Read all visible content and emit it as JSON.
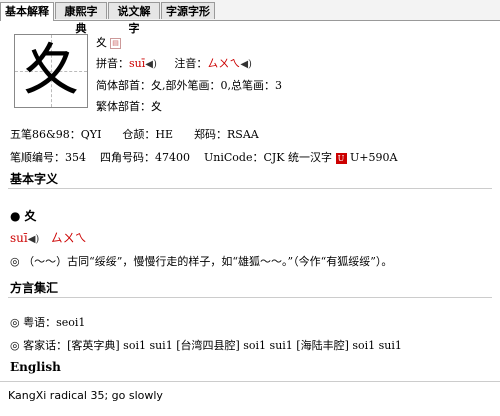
{
  "tabs": [
    "基本解释",
    "康熙字典",
    "说文解字",
    "字源字形"
  ],
  "char": "夊",
  "header": {
    "char_small": "夊",
    "pinyin_label": "拼音：",
    "pinyin": "suī",
    "zhuyin_label": "注音：",
    "zhuyin": "ㄙㄨㄟ",
    "radical_line": "简体部首：夂,部外笔画：0,总笔画：3",
    "trad_radical_line": "繁体部首：夊"
  },
  "codes": {
    "row1": [
      "五笔86&98：QYI",
      "仓颉：HE",
      "郑码：RSAA"
    ],
    "row2_a": "笔顺编号：354",
    "row2_b": "四角号码：47400",
    "row2_c": "UniCode：CJK 统一汉字",
    "row2_d": "U+590A"
  },
  "basic_heading": "基本字义",
  "entry": {
    "char": "夊",
    "pinyin": "suī",
    "zhuyin": "ㄙㄨㄟ",
    "definition": "◎ （～～）古同“绥绥”，慢慢行走的样子，如“雄狐～～。”（今作“有狐绥绥”）。"
  },
  "dialect_heading": "方言集汇",
  "dialect": [
    "◎ 粤语：seoi1",
    "◎ 客家话：[客英字典] soi1 sui1 [台湾四县腔] soi1 sui1 [海陆丰腔] soi1 sui1"
  ],
  "english_heading": "English",
  "english": "KangXi radical 35; go slowly"
}
